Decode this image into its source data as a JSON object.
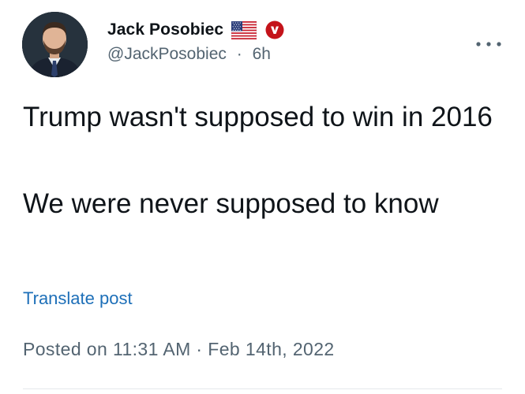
{
  "author": {
    "display_name": "Jack Posobiec",
    "handle": "@JackPosobiec",
    "separator": "·",
    "time_ago": "6h",
    "avatar_icon": "profile-photo",
    "badges": [
      "us-flag-icon",
      "verified-icon"
    ],
    "verified_color": "#c4131a"
  },
  "post": {
    "lines": [
      "Trump wasn't supposed to win in 2016",
      "We were never supposed to know"
    ],
    "translate_label": "Translate post",
    "posted_label": "Posted on 11:31 AM · Feb 14th, 2022"
  },
  "menu": {
    "icon": "more-options-icon"
  },
  "colors": {
    "text": "#0f1419",
    "muted": "#536471",
    "link": "#1d6fb8"
  }
}
